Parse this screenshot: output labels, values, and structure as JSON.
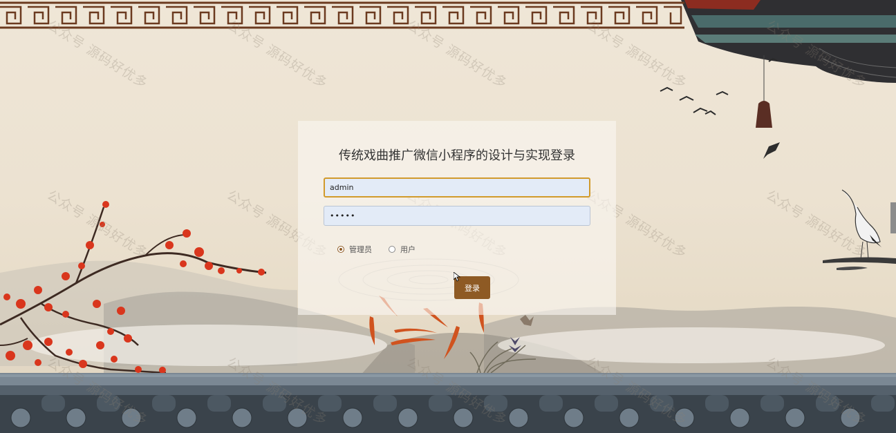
{
  "login": {
    "title": "传统戏曲推广微信小程序的设计与实现登录",
    "username_value": "admin",
    "password_value": "•••••",
    "roles": [
      "管理员",
      "用户"
    ],
    "selected_role": "管理员",
    "submit_label": "登录"
  },
  "watermark": {
    "text": "公众号 源码好优多"
  },
  "colors": {
    "accent_brown": "#8e5a24",
    "focus_border": "#d19a2b",
    "input_bg": "#e3ebf7",
    "lattice": "#6b3a1f",
    "blossom": "#d9361d"
  }
}
